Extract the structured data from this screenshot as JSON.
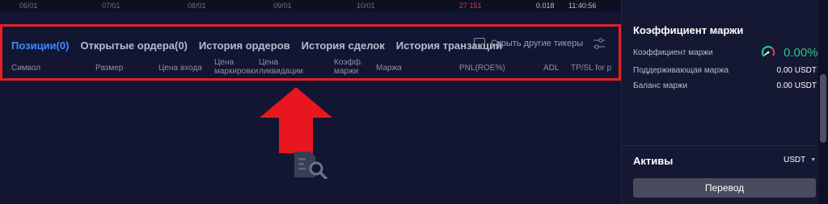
{
  "chart_strip": {
    "dates": [
      "06/01",
      "07/01",
      "08/01",
      "09/01",
      "10/01"
    ],
    "trade_price": "27 151",
    "trade_amount": "0.018",
    "trade_time": "11:40:56"
  },
  "positions_panel": {
    "tabs": [
      {
        "label": "Позиции(0)",
        "active": true
      },
      {
        "label": "Открытые ордера(0)",
        "active": false
      },
      {
        "label": "История ордеров",
        "active": false
      },
      {
        "label": "История сделок",
        "active": false
      },
      {
        "label": "История транзакций",
        "active": false
      }
    ],
    "hide_tickers_label": "Скрыть другие тикеры",
    "hide_tickers_checked": false,
    "columns": [
      {
        "label": "Символ"
      },
      {
        "label": "Размер"
      },
      {
        "label": "Цена входа"
      },
      {
        "label": "Цена маркировки"
      },
      {
        "label": "Цена ликвидации"
      },
      {
        "label": "Коэфф. маржи"
      },
      {
        "label": "Маржа"
      },
      {
        "label": "PNL(ROE%)"
      },
      {
        "label": "ADL"
      },
      {
        "label": "TP/SL for p"
      }
    ]
  },
  "margin_panel": {
    "title": "Коэффициент маржи",
    "margin_ratio_label": "Коэффициент маржи",
    "margin_ratio_value": "0.00%",
    "maintenance_margin_label": "Поддерживающая маржа",
    "maintenance_margin_value": "0.00 USDT",
    "margin_balance_label": "Баланс маржи",
    "margin_balance_value": "0.00 USDT"
  },
  "assets_panel": {
    "title": "Активы",
    "currency": "USDT",
    "transfer_label": "Перевод"
  },
  "colors": {
    "accent": "#3d8bff",
    "highlight_border": "#e52027",
    "positive": "#2bc58a",
    "background": "#121632"
  }
}
